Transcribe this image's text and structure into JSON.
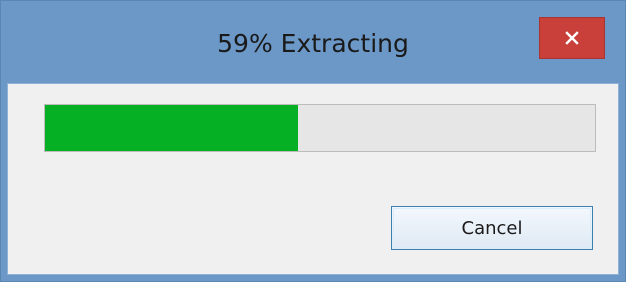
{
  "dialog": {
    "title": "59% Extracting",
    "close_icon": "close-icon",
    "progress": {
      "fraction": 0.46,
      "fill_color": "#06b025",
      "track_color": "#e6e6e6"
    },
    "cancel_label": "Cancel"
  },
  "colors": {
    "frame": "#6b98c7",
    "close_button": "#c9403a",
    "client_background": "#f0f0f0"
  }
}
